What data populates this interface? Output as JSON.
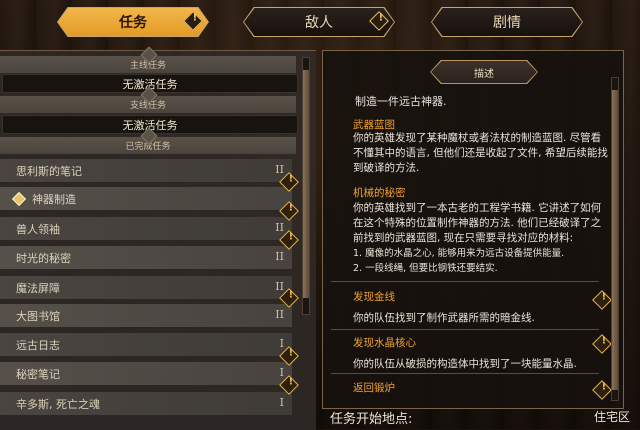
{
  "tabs": [
    {
      "label": "任务",
      "active": true
    },
    {
      "label": "敌人",
      "active": false
    },
    {
      "label": "剧情",
      "active": false
    }
  ],
  "left": {
    "main_header": "主线任务",
    "main_value": "无激活任务",
    "side_header": "支线任务",
    "side_value": "无激活任务",
    "completed_header": "已完成任务",
    "quests": [
      {
        "label": "思利斯的笔记",
        "roman": "II"
      },
      {
        "label": "神器制造",
        "roman": "",
        "selected": true
      },
      {
        "label": "兽人领袖",
        "roman": "II"
      },
      {
        "label": "时光的秘密",
        "roman": "II"
      },
      {
        "label": "魔法屏障",
        "roman": "II"
      },
      {
        "label": "大图书馆",
        "roman": "II"
      },
      {
        "label": "远古日志",
        "roman": "I"
      },
      {
        "label": "秘密笔记",
        "roman": "I"
      },
      {
        "label": "辛多斯, 死亡之魂",
        "roman": "I"
      }
    ]
  },
  "right": {
    "tab_label": "描述",
    "intro": "制造一件远古神器.",
    "sections": [
      {
        "title": "武器蓝图",
        "lines": [
          "你的英雄发现了某种魔杖或者法杖的制造蓝图. 尽管看",
          "不懂其中的语言, 但他们还是收起了文件, 希望后续能找",
          "到破译的方法."
        ]
      },
      {
        "title": "机械的秘密",
        "lines": [
          "你的英雄找到了一本古老的工程学书籍. 它讲述了如何",
          "在这个特殊的位置制作神器的方法. 他们已经破译了之",
          "前找到的武器蓝图, 现在只需要寻找对应的材料:",
          "1. 魔像的水晶之心, 能够用来为远古设备提供能量.",
          "2. 一段线绳, 但要比钢铁还要结实."
        ]
      },
      {
        "title": "发现金线",
        "lines": [
          "你的队伍找到了制作武器所需的暗金线."
        ]
      },
      {
        "title": "发现水晶核心",
        "lines": [
          "你的队伍从破损的构造体中找到了一块能量水晶."
        ]
      },
      {
        "title": "返回锻炉",
        "lines": []
      }
    ]
  },
  "footer": {
    "start_label": "任务开始地点:",
    "location": "住宅区"
  },
  "colors": {
    "accent": "#f0a22c",
    "tab_active": "#e39a25"
  }
}
